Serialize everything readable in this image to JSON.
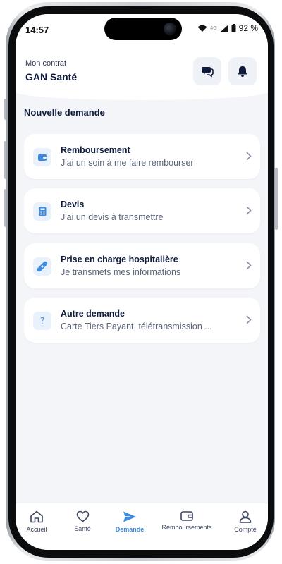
{
  "status_bar": {
    "time": "14:57",
    "network": "4G",
    "battery": "92 %"
  },
  "header": {
    "label": "Mon contrat",
    "contract_name": "GAN Santé",
    "icons": [
      "chat-icon",
      "bell-icon"
    ]
  },
  "section_title": "Nouvelle demande",
  "requests": [
    {
      "title": "Remboursement",
      "subtitle": "J'ai un soin à me faire rembourser",
      "icon": "wallet-icon"
    },
    {
      "title": "Devis",
      "subtitle": "J'ai un devis à transmettre",
      "icon": "calculator-icon"
    },
    {
      "title": "Prise en charge hospitalière",
      "subtitle": "Je transmets mes informations",
      "icon": "bandage-icon"
    },
    {
      "title": "Autre demande",
      "subtitle": "Carte Tiers Payant, télétransmission ...",
      "icon": "question-icon"
    }
  ],
  "tabs": [
    {
      "label": "Accueil",
      "icon": "home-icon"
    },
    {
      "label": "Santé",
      "icon": "heart-icon"
    },
    {
      "label": "Demande",
      "icon": "send-icon",
      "active": true
    },
    {
      "label": "Remboursements",
      "icon": "wallet-icon"
    },
    {
      "label": "Compte",
      "icon": "user-icon"
    }
  ],
  "colors": {
    "accent": "#3d8be0",
    "text_dark": "#0f1b3d",
    "background": "#f3f5f8"
  }
}
